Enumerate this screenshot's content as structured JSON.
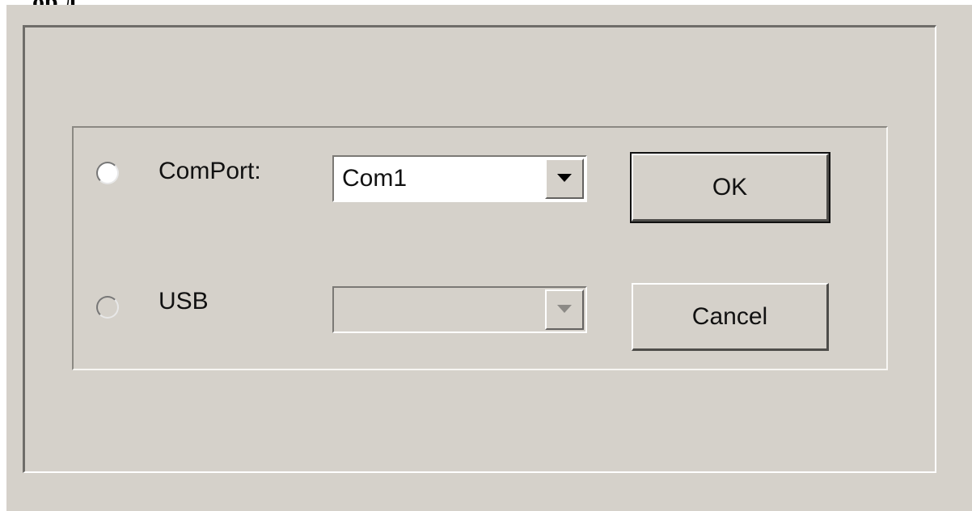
{
  "header": {
    "cropped_text": "ор  д"
  },
  "dialog": {
    "options": [
      {
        "label": "ComPort:",
        "selected": false
      },
      {
        "label": "USB",
        "selected": false
      }
    ],
    "comport_select": {
      "value": "Com1"
    },
    "usb_select": {
      "value": ""
    },
    "buttons": {
      "ok": "OK",
      "cancel": "Cancel"
    }
  },
  "colors": {
    "window_background": "#d5d1ca",
    "border_dark": "#6f6d69",
    "highlight": "#ffffff"
  }
}
